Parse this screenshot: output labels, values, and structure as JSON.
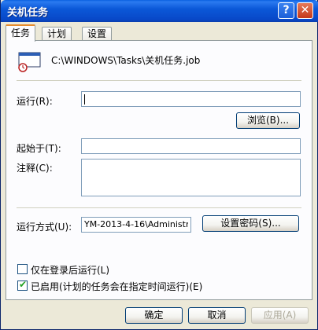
{
  "window": {
    "title": "关机任务",
    "help_glyph": "?",
    "close_glyph": "✕"
  },
  "tabs": [
    {
      "label": "任务",
      "active": true
    },
    {
      "label": "计划",
      "active": false
    },
    {
      "label": "设置",
      "active": false
    }
  ],
  "task": {
    "path": "C:\\WINDOWS\\Tasks\\关机任务.job",
    "icon": "scheduled-task-icon"
  },
  "fields": {
    "run_label": "运行(R):",
    "run_value": "",
    "browse_button": "浏览(B)...",
    "start_in_label": "起始于(T):",
    "start_in_value": "",
    "comments_label": "注释(C):",
    "comments_value": "",
    "run_as_label": "运行方式(U):",
    "run_as_value": "YM-2013-4-16\\Administr",
    "set_password_button": "设置密码(S)..."
  },
  "options": {
    "logged_on_only_label": "仅在登录后运行(L)",
    "logged_on_only_checked": false,
    "enabled_label": "已启用(计划的任务会在指定时间运行)(E)",
    "enabled_checked": true
  },
  "footer": {
    "ok": "确定",
    "cancel": "取消",
    "apply": "应用(A)"
  },
  "colors": {
    "titlebar": "#0b58d8",
    "tab_highlight": "#e68b2c",
    "dialog_bg": "#ece9d8",
    "check": "#21a121"
  }
}
